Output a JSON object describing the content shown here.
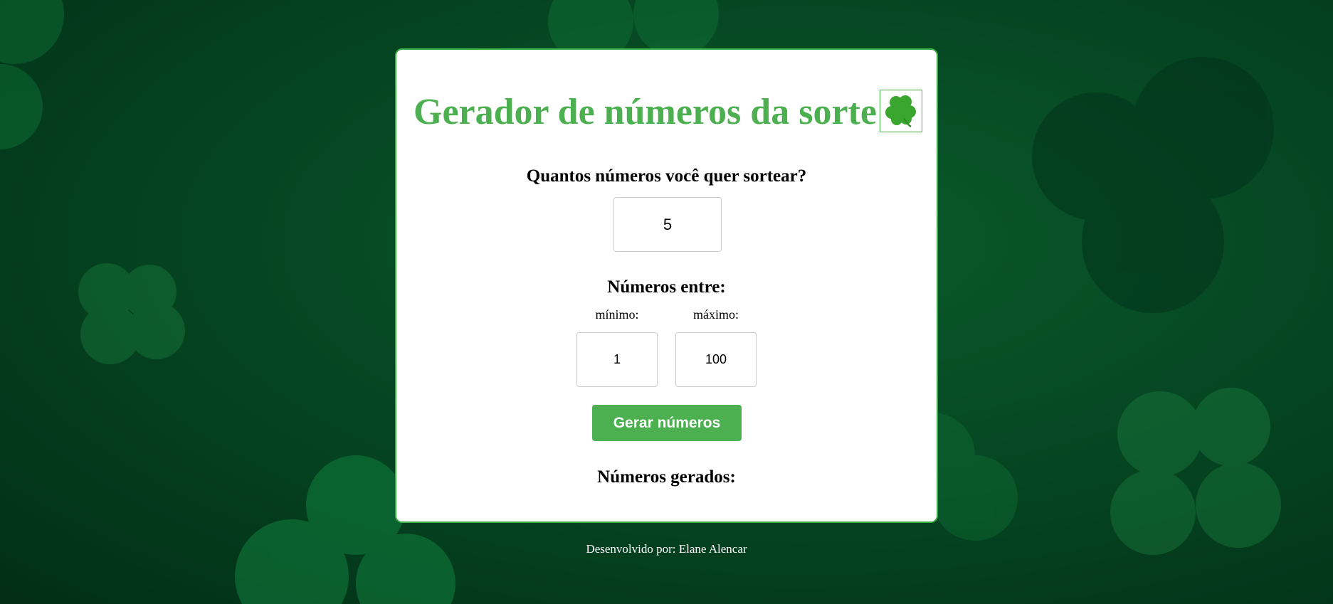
{
  "app": {
    "title": "Gerador de números da sorte",
    "title_icon": "four-leaf-clover-icon"
  },
  "form": {
    "count_question": "Quantos números você quer sortear?",
    "count_value": "5",
    "range_heading": "Números entre:",
    "min_label": "mínimo:",
    "min_value": "1",
    "max_label": "máximo:",
    "max_value": "100",
    "generate_button": "Gerar números"
  },
  "results": {
    "heading": "Números gerados:"
  },
  "footer": {
    "credit": "Desenvolvido por: Elane Alencar"
  },
  "colors": {
    "accent": "#4caf50",
    "background": "#064a24",
    "card": "#ffffff"
  }
}
